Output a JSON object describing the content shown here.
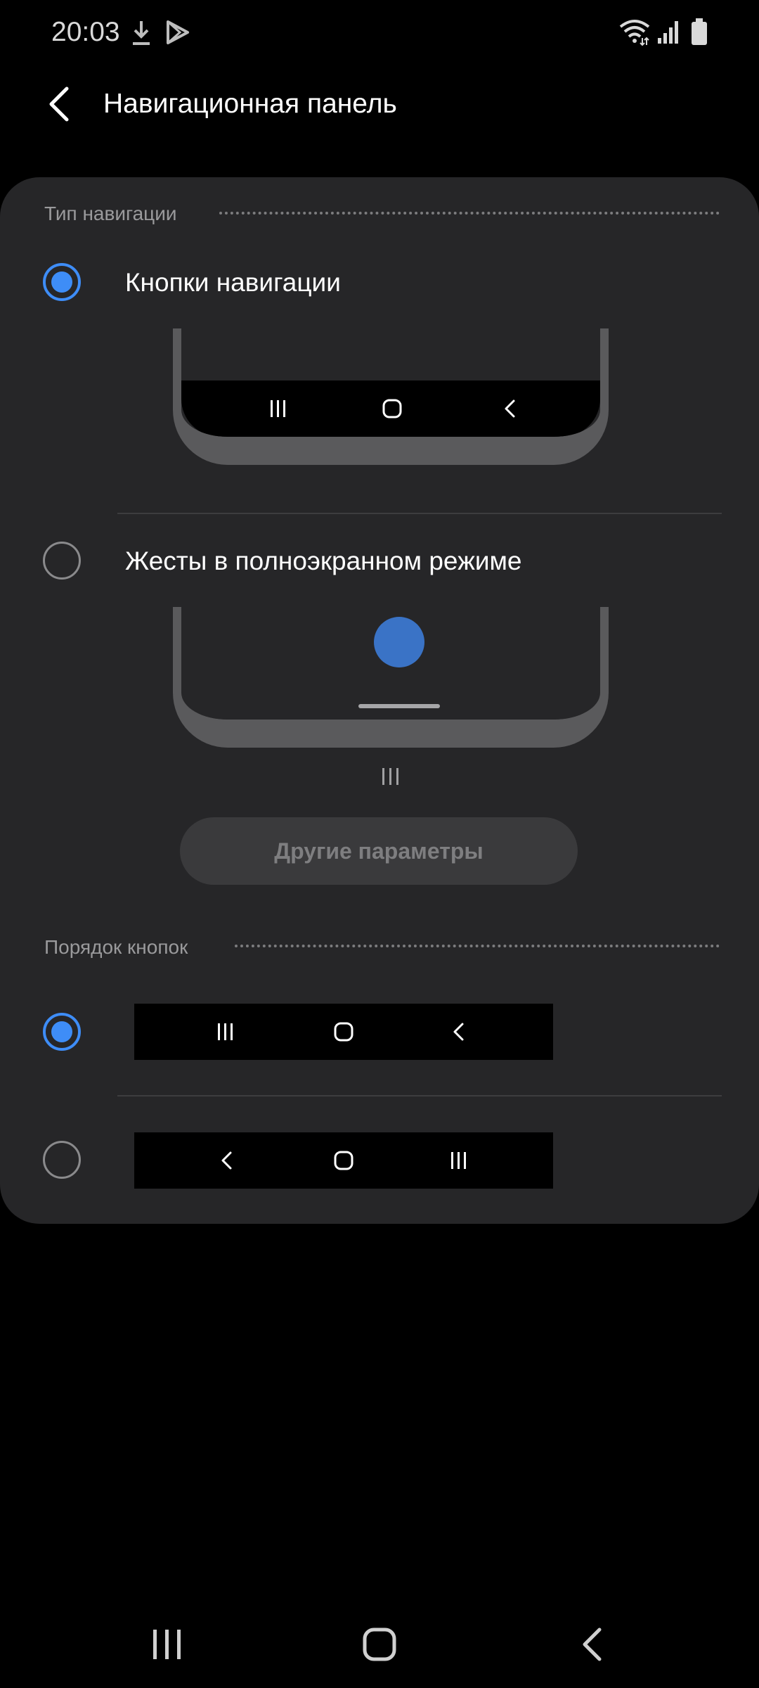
{
  "status_bar": {
    "time": "20:03",
    "left_icons": [
      "download-icon",
      "play-store-icon"
    ],
    "right_icons": [
      "wifi-icon",
      "signal-icon",
      "battery-icon"
    ]
  },
  "header": {
    "title": "Навигационная панель",
    "back_icon": "chevron-left-icon"
  },
  "nav_type": {
    "section_label": "Тип навигации",
    "options": [
      {
        "label": "Кнопки навигации",
        "selected": true
      },
      {
        "label": "Жесты в полноэкранном режиме",
        "selected": false
      }
    ],
    "more_button": "Другие параметры"
  },
  "button_order": {
    "section_label": "Порядок кнопок",
    "options": [
      {
        "order": [
          "recents-icon",
          "home-icon",
          "back-icon"
        ],
        "selected": true
      },
      {
        "order": [
          "back-icon",
          "home-icon",
          "recents-icon"
        ],
        "selected": false
      }
    ]
  },
  "system_nav": [
    "recents-icon",
    "home-icon",
    "back-icon"
  ],
  "colors": {
    "accent": "#3e8df7",
    "card_bg": "#262628",
    "background": "#000000"
  }
}
